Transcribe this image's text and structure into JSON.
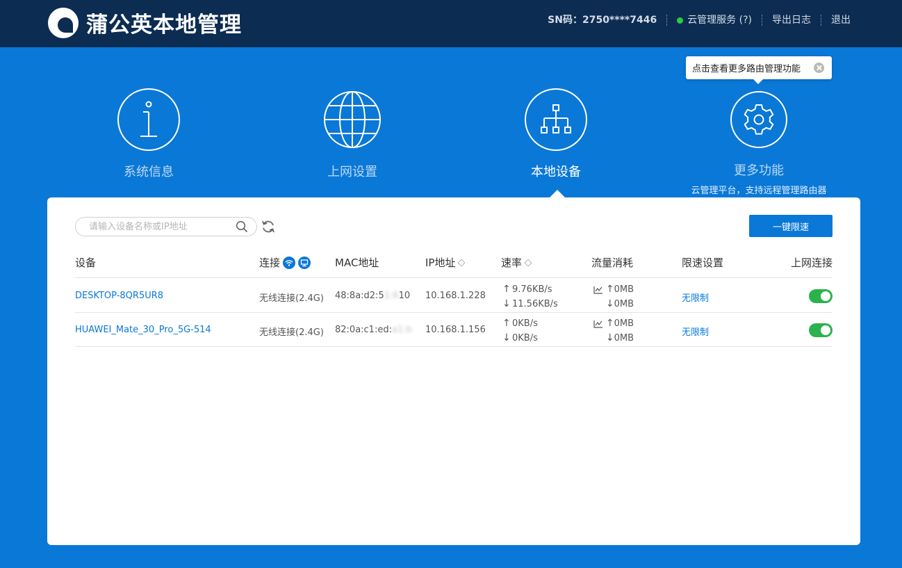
{
  "header": {
    "title": "蒲公英本地管理",
    "sn_label": "SN码：",
    "sn_value": "2750****7446",
    "cloud_service": "云管理服务 (?)",
    "export_log": "导出日志",
    "logout": "退出"
  },
  "tooltip": {
    "text": "点击查看更多路由管理功能"
  },
  "nav": {
    "system_info": "系统信息",
    "internet_settings": "上网设置",
    "local_devices": "本地设备",
    "more_features": "更多功能",
    "more_features_sub": "云管理平台，支持远程管理路由器",
    "active": "local_devices"
  },
  "toolbar": {
    "search_placeholder": "请输入设备名称或IP地址",
    "limit_all_button": "一键限速"
  },
  "table": {
    "headers": {
      "device": "设备",
      "connection": "连接",
      "mac": "MAC地址",
      "ip": "IP地址",
      "speed": "速率",
      "traffic": "流量消耗",
      "limit": "限速设置",
      "internet": "上网连接"
    },
    "rows": [
      {
        "device": "DESKTOP-8QR5UR8",
        "connection": "无线连接(2.4G)",
        "mac_visible": "48:8a:d2:5",
        "mac_hidden": "1:6",
        "mac_tail": "10",
        "ip": "10.168.1.228",
        "speed_up": "9.76KB/s",
        "speed_down": "11.56KB/s",
        "traffic_up": "0MB",
        "traffic_down": "0MB",
        "limit": "无限制",
        "internet_on": true
      },
      {
        "device": "HUAWEI_Mate_30_Pro_5G-514",
        "connection": "无线连接(2.4G)",
        "mac_visible": "82:0a:c1:ed:",
        "mac_hidden": "a1:b",
        "mac_tail": "",
        "ip": "10.168.1.156",
        "speed_up": "0KB/s",
        "speed_down": "0KB/s",
        "traffic_up": "0MB",
        "traffic_down": "0MB",
        "limit": "无限制",
        "internet_on": true
      }
    ]
  },
  "colors": {
    "header_bg": "#0c2c52",
    "page_bg": "#0a78d7",
    "accent": "#0a78d7",
    "toggle_on": "#2bb24c",
    "status_online": "#2ecc40"
  }
}
